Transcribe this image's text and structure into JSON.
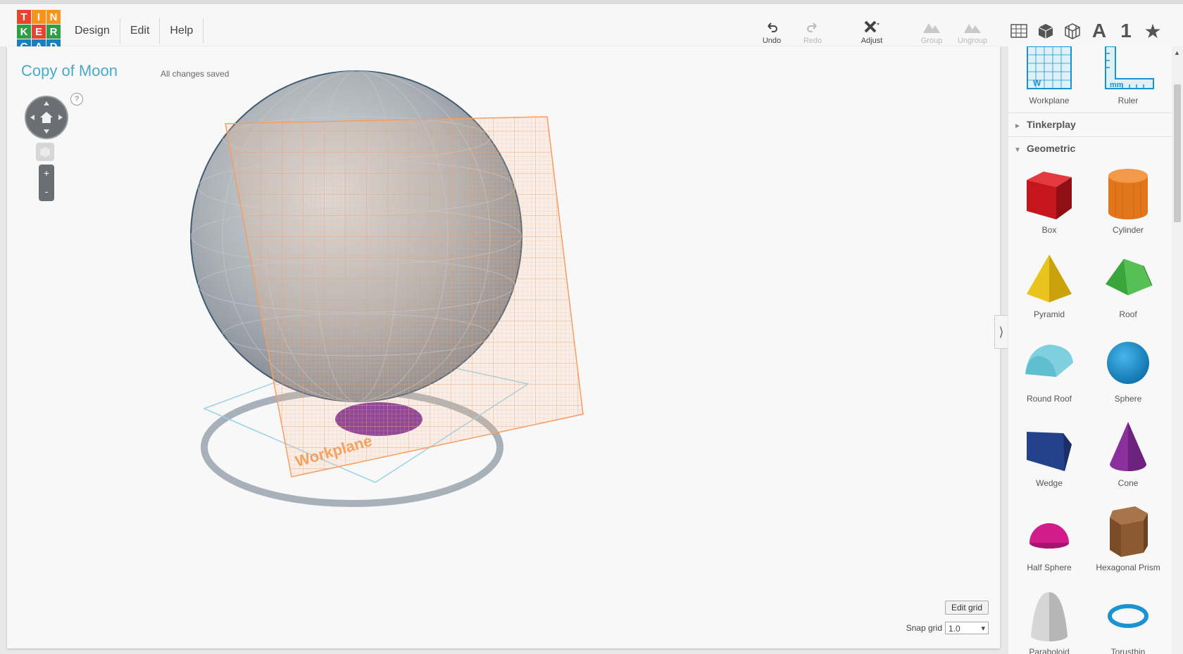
{
  "logo": {
    "letters": [
      "T",
      "I",
      "N",
      "K",
      "E",
      "R",
      "C",
      "A",
      "D"
    ],
    "colors": [
      "#e8432f",
      "#f7941d",
      "#f7941d",
      "#2d9f47",
      "#e8432f",
      "#2d9f47",
      "#1a7fc1",
      "#1a7fc1",
      "#1a7fc1"
    ]
  },
  "menu": [
    {
      "label": "Design"
    },
    {
      "label": "Edit"
    },
    {
      "label": "Help"
    }
  ],
  "toolbar": {
    "undo": "Undo",
    "redo": "Redo",
    "adjust": "Adjust",
    "group": "Group",
    "ungroup": "Ungroup"
  },
  "view_icons": [
    "grid-view-icon",
    "solid-cube-icon",
    "wireframe-cube-icon",
    "text-tool-icon",
    "number-tool-icon",
    "favorites-star-icon"
  ],
  "view_glyphs": [
    "",
    "",
    "",
    "A",
    "1",
    "★"
  ],
  "workspace": {
    "title": "Copy of Moon",
    "saved": "All changes saved",
    "workplane_label": "Workplane",
    "help": "?",
    "zoom_in": "+",
    "zoom_out": "-",
    "edit_grid": "Edit grid",
    "snap_label": "Snap grid",
    "snap_value": "1.0"
  },
  "sidebar": {
    "top_tools": [
      {
        "label": "Workplane"
      },
      {
        "label": "Ruler"
      }
    ],
    "sections": [
      {
        "label": "Tinkerplay",
        "expanded": false
      },
      {
        "label": "Geometric",
        "expanded": true
      }
    ],
    "shapes": [
      {
        "label": "Box",
        "color": "#c4161c"
      },
      {
        "label": "Cylinder",
        "color": "#e2761b"
      },
      {
        "label": "Pyramid",
        "color": "#e9c41c"
      },
      {
        "label": "Roof",
        "color": "#3aa53a"
      },
      {
        "label": "Round Roof",
        "color": "#5fbfd0"
      },
      {
        "label": "Sphere",
        "color": "#1a93d0"
      },
      {
        "label": "Wedge",
        "color": "#24418c"
      },
      {
        "label": "Cone",
        "color": "#8a2f9c"
      },
      {
        "label": "Half Sphere",
        "color": "#d21c8c"
      },
      {
        "label": "Hexagonal Prism",
        "color": "#8b5a32"
      },
      {
        "label": "Paraboloid",
        "color": "#c8c8c8"
      },
      {
        "label": "Torusthin",
        "color": "#1a93d0"
      }
    ]
  },
  "colors": {
    "accent": "#4aa9c8",
    "workplane": "#f79a5a",
    "sphere": "#9da3aa",
    "base": "#7b2e96"
  }
}
